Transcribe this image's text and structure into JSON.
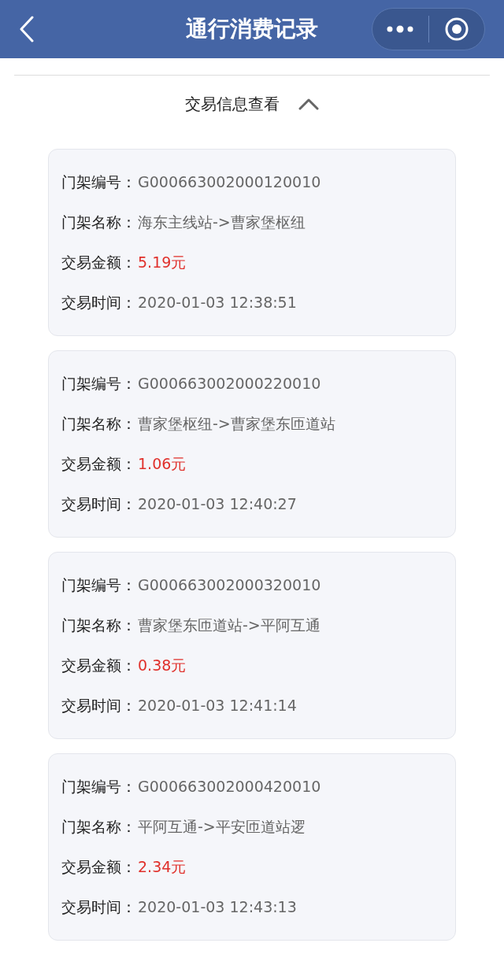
{
  "nav_bar": {
    "title": "通行消费记录"
  },
  "section": {
    "title": "交易信息查看",
    "expanded": true
  },
  "records": [
    {
      "fields": [
        {
          "label": "门架编号：",
          "value": "G000663002000120010",
          "kind": "text"
        },
        {
          "label": "门架名称：",
          "value": "海东主线站->曹家堡枢纽",
          "kind": "text"
        },
        {
          "label": "交易金额：",
          "value": "5.19元",
          "kind": "amount"
        },
        {
          "label": "交易时间：",
          "value": "2020-01-03 12:38:51",
          "kind": "text"
        }
      ]
    },
    {
      "fields": [
        {
          "label": "门架编号：",
          "value": "G000663002000220010",
          "kind": "text"
        },
        {
          "label": "门架名称：",
          "value": "曹家堡枢纽->曹家堡东匝道站",
          "kind": "text"
        },
        {
          "label": "交易金额：",
          "value": "1.06元",
          "kind": "amount"
        },
        {
          "label": "交易时间：",
          "value": "2020-01-03 12:40:27",
          "kind": "text"
        }
      ]
    },
    {
      "fields": [
        {
          "label": "门架编号：",
          "value": "G000663002000320010",
          "kind": "text"
        },
        {
          "label": "门架名称：",
          "value": "曹家堡东匝道站->平阿互通",
          "kind": "text"
        },
        {
          "label": "交易金额：",
          "value": "0.38元",
          "kind": "amount"
        },
        {
          "label": "交易时间：",
          "value": "2020-01-03 12:41:14",
          "kind": "text"
        }
      ]
    },
    {
      "fields": [
        {
          "label": "门架编号：",
          "value": "G000663002000420010",
          "kind": "text"
        },
        {
          "label": "门架名称：",
          "value": "平阿互通->平安匝道站逻",
          "kind": "text"
        },
        {
          "label": "交易金额：",
          "value": "2.34元",
          "kind": "amount"
        },
        {
          "label": "交易时间：",
          "value": "2020-01-03 12:43:13",
          "kind": "text"
        }
      ]
    }
  ]
}
